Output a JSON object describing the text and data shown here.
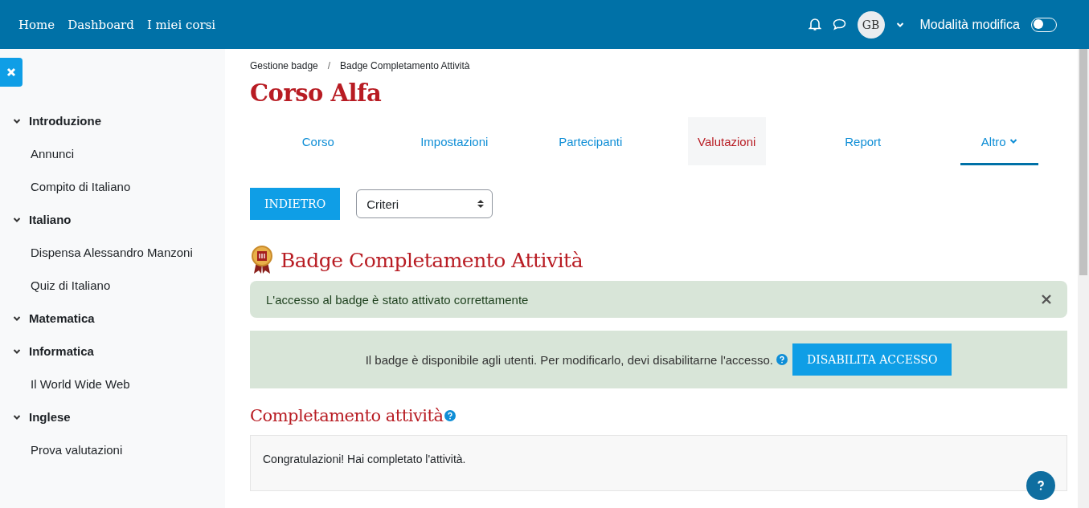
{
  "navbar": {
    "links": [
      {
        "label": "Home"
      },
      {
        "label": "Dashboard"
      },
      {
        "label": "I miei corsi"
      }
    ],
    "avatar": "GB",
    "edit_mode": {
      "label": "Modalità modifica",
      "on": false
    }
  },
  "course_index": {
    "items": [
      {
        "label": "Introduzione",
        "expanded": true,
        "children": [
          {
            "label": "Annunci"
          },
          {
            "label": "Compito di Italiano"
          }
        ]
      },
      {
        "label": "Italiano",
        "expanded": true,
        "children": [
          {
            "label": "Dispensa Alessandro Manzoni"
          },
          {
            "label": "Quiz di Italiano"
          }
        ]
      },
      {
        "label": "Matematica",
        "expanded": true
      },
      {
        "label": "Informatica",
        "expanded": true,
        "children": [
          {
            "label": "Il World Wide Web"
          }
        ]
      },
      {
        "label": "Inglese",
        "expanded": true,
        "children": [
          {
            "label": "Prova valutazioni"
          }
        ]
      }
    ]
  },
  "breadcrumb": [
    "Gestione badge",
    "/",
    "Badge Completamento Attività"
  ],
  "course_title": "Corso Alfa",
  "tabs": [
    {
      "label": "Corso",
      "selected": false,
      "hovered": false
    },
    {
      "label": "Impostazioni",
      "selected": false,
      "hovered": false
    },
    {
      "label": "Partecipanti",
      "selected": false,
      "hovered": false
    },
    {
      "label": "Valutazioni",
      "selected": false,
      "hovered": true
    },
    {
      "label": "Report",
      "selected": false,
      "hovered": false
    },
    {
      "label": "Altro",
      "selected": true,
      "hovered": false,
      "dropdown": true
    }
  ],
  "back_button": "INDIETRO",
  "select": {
    "value": "Criteri"
  },
  "badge_title": "Badge Completamento Attività",
  "alert": {
    "text": "L'accesso al badge è stato attivato correttamente"
  },
  "status_box": {
    "text": "Il badge è disponibile agli utenti. Per modificarlo, devi disabilitarne l'accesso.",
    "button": "DISABILITA ACCESSO"
  },
  "section_title": "Completamento attività",
  "message": "Congratulazioni! Hai completato l'attività."
}
